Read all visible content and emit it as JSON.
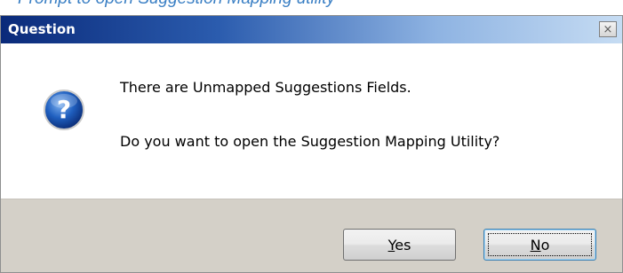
{
  "caption": "Prompt to open Suggestion Mapping utility",
  "dialog": {
    "title": "Question",
    "close_label": "×",
    "icon": "question-icon",
    "message_line1": "There are Unmapped Suggestions Fields.",
    "message_line2": "Do you want to open the Suggestion Mapping Utility?",
    "buttons": {
      "yes": {
        "mnemonic": "Y",
        "rest": "es"
      },
      "no": {
        "mnemonic": "N",
        "rest": "o"
      }
    }
  },
  "colors": {
    "caption": "#3a7fc4",
    "title_bar_start": "#0a2a7a",
    "title_bar_end": "#c6dcf3",
    "footer": "#d4d0c8",
    "icon_blue": "#1f5fbf"
  }
}
